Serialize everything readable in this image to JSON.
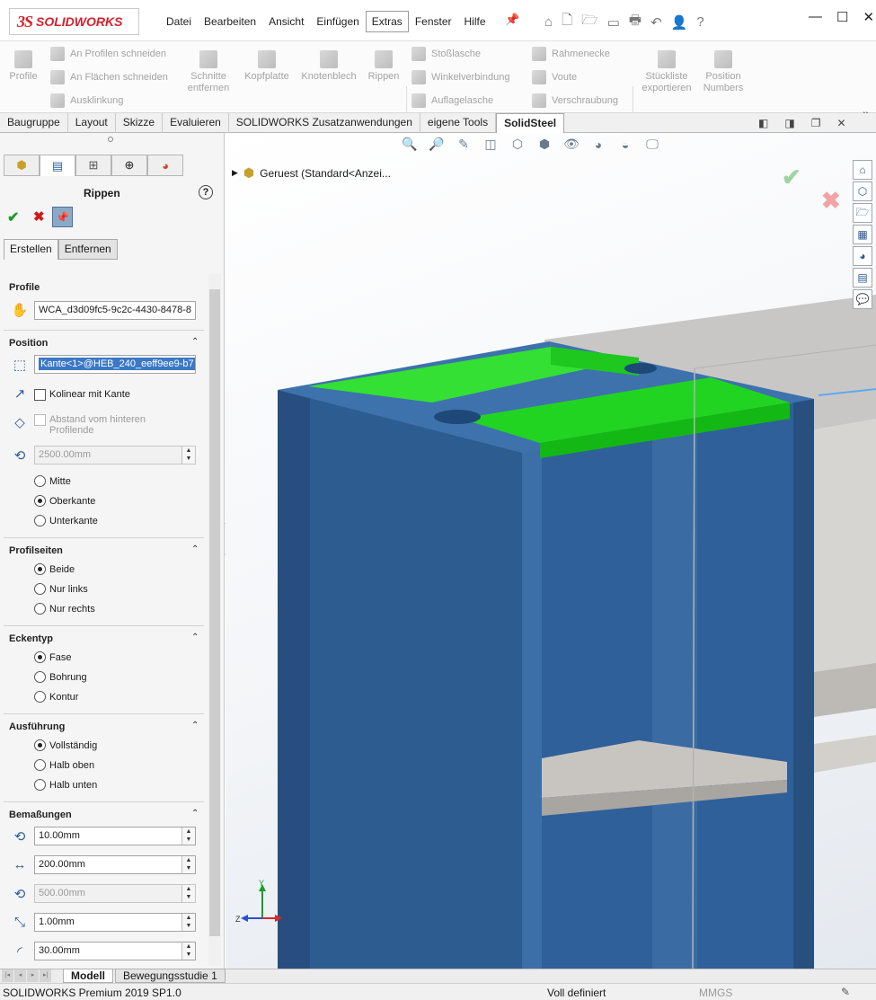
{
  "app": {
    "logo_ds": "3S",
    "logo_text": "SOLIDWORKS"
  },
  "menu": [
    "Datei",
    "Bearbeiten",
    "Ansicht",
    "Einfügen",
    "Extras",
    "Fenster",
    "Hilfe"
  ],
  "command_manager": {
    "profile": "Profile",
    "an_profilen": "An Profilen schneiden",
    "an_flaechen": "An Flächen schneiden",
    "ausklinkung": "Ausklinkung",
    "schnitte_1": "Schnitte",
    "schnitte_2": "entfernen",
    "kopfplatte": "Kopfplatte",
    "knotenblech": "Knotenblech",
    "rippen": "Rippen",
    "stosslasche": "Stoßlasche",
    "winkelverbindung": "Winkelverbindung",
    "auflagelasche": "Auflagelasche",
    "rahmenecke": "Rahmenecke",
    "voute": "Voute",
    "verschraubung": "Verschraubung",
    "stueckliste_1": "Stückliste",
    "stueckliste_2": "exportieren",
    "position_1": "Position",
    "position_2": "Numbers"
  },
  "tabs": [
    "Baugruppe",
    "Layout",
    "Skizze",
    "Evaluieren",
    "SOLIDWORKS Zusatzanwendungen",
    "eigene Tools",
    "SolidSteel"
  ],
  "panel": {
    "title": "Rippen",
    "subtabs": [
      "Erstellen",
      "Entfernen"
    ],
    "profile": {
      "header": "Profile",
      "value": "WCA_d3d09fc5-9c2c-4430-8478-8"
    },
    "position": {
      "header": "Position",
      "edge_value": "Kante<1>@HEB_240_eeff9ee9-b7",
      "kolinear": "Kolinear mit Kante",
      "abstand": "Abstand vom hinteren Profilende",
      "distance": "2500.00mm",
      "mitte": "Mitte",
      "oberkante": "Oberkante",
      "unterkante": "Unterkante"
    },
    "profilseiten": {
      "header": "Profilseiten",
      "beide": "Beide",
      "nur_links": "Nur links",
      "nur_rechts": "Nur rechts"
    },
    "eckentyp": {
      "header": "Eckentyp",
      "fase": "Fase",
      "bohrung": "Bohrung",
      "kontur": "Kontur"
    },
    "ausfuehrung": {
      "header": "Ausführung",
      "vollstaendig": "Vollständig",
      "halb_oben": "Halb oben",
      "halb_unten": "Halb unten"
    },
    "bemassungen": {
      "header": "Bemaßungen",
      "d1": "10.00mm",
      "d2": "200.00mm",
      "d3": "500.00mm",
      "d4": "1.00mm",
      "d5": "30.00mm"
    }
  },
  "viewport": {
    "tree_root": "Geruest  (Standard<Anzei..."
  },
  "bottom_tabs": [
    "Modell",
    "Bewegungsstudie 1"
  ],
  "status": {
    "product": "SOLIDWORKS Premium 2019 SP1.0",
    "state": "Voll definiert",
    "units": "MMGS"
  },
  "colors": {
    "accent": "#3b78c6",
    "brand": "#d6202a",
    "steel_blue": "#2f5f96",
    "rib_green": "#22d422"
  }
}
